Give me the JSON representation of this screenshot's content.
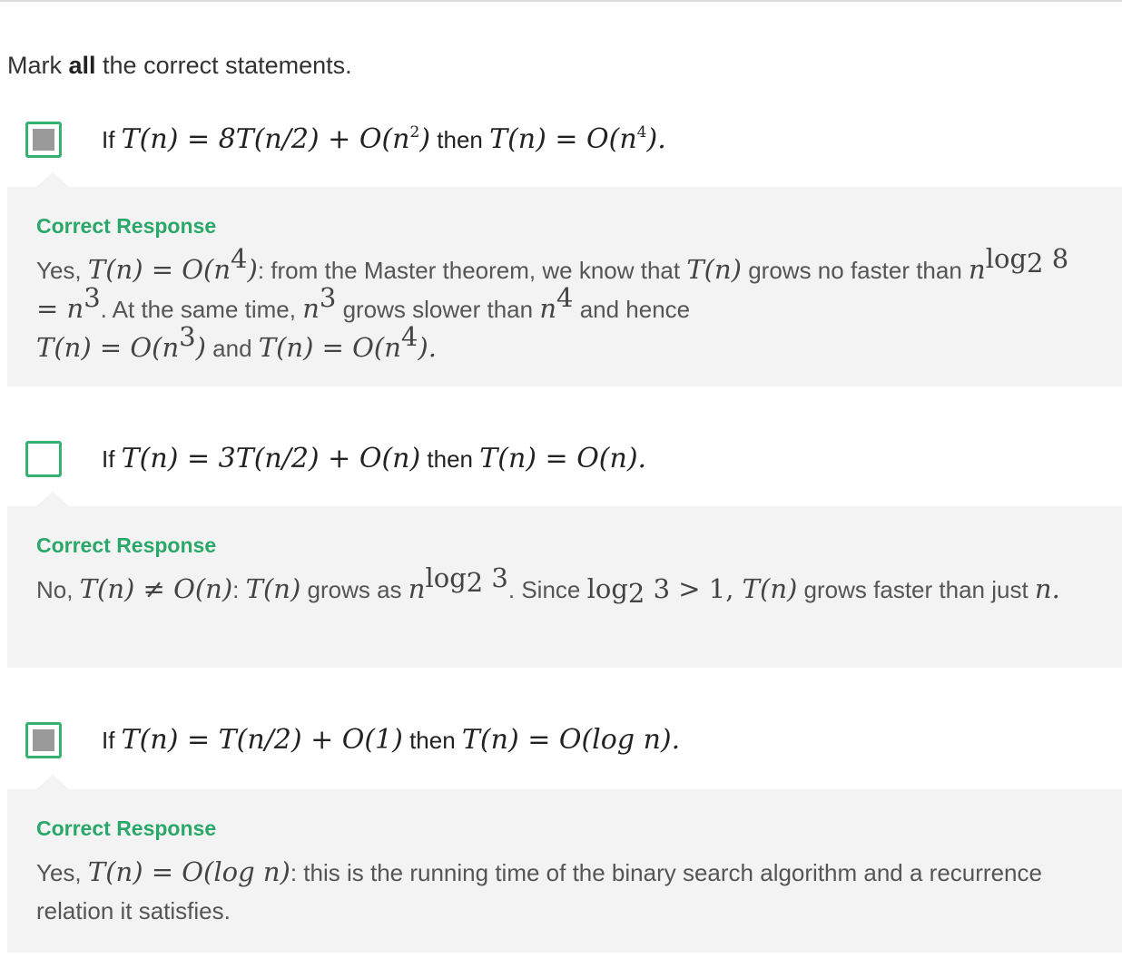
{
  "prompt": {
    "before": "Mark ",
    "bold": "all",
    "after": " the correct statements."
  },
  "options": [
    {
      "checked": true,
      "statement_parts": [
        "If ",
        "T(n) = 8T(n/2) + O(n",
        "2",
        ")",
        " then ",
        "T(n) = O(n",
        "4",
        ").",
        ""
      ],
      "feedback_title": "Correct Response",
      "feedback_parts": [
        "Yes, ",
        "T(n) = O(n",
        "4",
        ")",
        ": from the Master theorem, we know that ",
        "T(n)",
        " grows no faster than ",
        "n",
        "log",
        "2",
        " 8",
        " = n",
        "3",
        ". At the same time, ",
        "n",
        "3",
        " grows slower than ",
        "n",
        "4",
        " and hence ",
        "T(n) = O(n",
        "3",
        ")",
        " and ",
        "T(n) = O(n",
        "4",
        ")."
      ]
    },
    {
      "checked": false,
      "statement_parts": [
        "If ",
        "T(n) = 3T(n/2) + O(n)",
        " then ",
        "T(n) = O(n)."
      ],
      "feedback_title": "Correct Response",
      "feedback_parts": [
        "No, ",
        "T(n) ≠ O(n)",
        ": ",
        "T(n)",
        " grows as ",
        "n",
        "log",
        "2",
        " 3",
        ". Since ",
        "log",
        "2",
        " 3 > 1, ",
        "T(n)",
        " grows faster than just ",
        "n."
      ]
    },
    {
      "checked": true,
      "statement_parts": [
        "If ",
        "T(n) = T(n/2) + O(1)",
        " then ",
        "T(n) = O(log n)."
      ],
      "feedback_title": "Correct Response",
      "feedback_parts": [
        "Yes, ",
        "T(n) = O(log n)",
        ": this is the running time of the binary search algorithm and a recurrence relation it satisfies."
      ]
    }
  ]
}
